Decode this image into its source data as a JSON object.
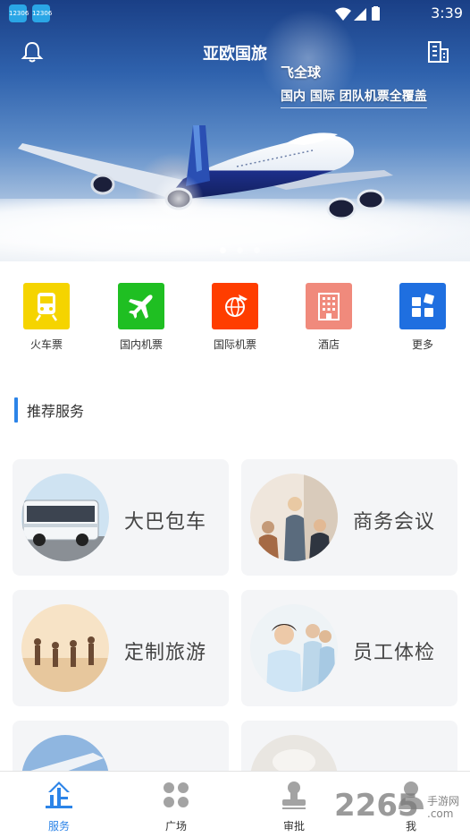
{
  "status_bar": {
    "time": "3:39",
    "left_icons": [
      "12306-app-icon",
      "12306-app-icon"
    ],
    "left_icon_text": "12306",
    "right_icons": [
      "wifi-icon",
      "signal-icon",
      "battery-icon"
    ]
  },
  "header": {
    "title": "亚欧国旅",
    "left_icon": "bell-icon",
    "right_icon": "building-icon"
  },
  "banner": {
    "slogan_line1": "飞全球",
    "slogan_line2": "国内 国际 团队机票全覆盖",
    "image": "airplane-above-clouds",
    "page_count": 3,
    "active_page": 1
  },
  "quick_menu": [
    {
      "label": "火车票",
      "icon": "train-icon",
      "color": "#f5d400"
    },
    {
      "label": "国内机票",
      "icon": "plane-icon",
      "color": "#1fbf22"
    },
    {
      "label": "国际机票",
      "icon": "globe-plane-icon",
      "color": "#ff3d00"
    },
    {
      "label": "酒店",
      "icon": "hotel-icon",
      "color": "#f08a7c"
    },
    {
      "label": "更多",
      "icon": "grid-icon",
      "color": "#1f6fe0"
    }
  ],
  "section": {
    "title": "推荐服务"
  },
  "services": [
    {
      "label": "大巴包车",
      "image": "bus-photo"
    },
    {
      "label": "商务会议",
      "image": "meeting-photo"
    },
    {
      "label": "定制旅游",
      "image": "beach-photo"
    },
    {
      "label": "员工体检",
      "image": "nurses-photo"
    },
    {
      "label": "",
      "image": "airplane-photo"
    },
    {
      "label": "",
      "image": "office-photo"
    }
  ],
  "bottom_nav": [
    {
      "label": "服务",
      "icon": "enterprise-icon",
      "active": true
    },
    {
      "label": "广场",
      "icon": "apps-icon",
      "active": false
    },
    {
      "label": "审批",
      "icon": "stamp-icon",
      "active": false
    },
    {
      "label": "我",
      "icon": "person-icon",
      "active": false
    }
  ],
  "watermark": {
    "number": "2265",
    "text": "手游网",
    "domain": ".com"
  },
  "colors": {
    "accent": "#2c84e8"
  }
}
